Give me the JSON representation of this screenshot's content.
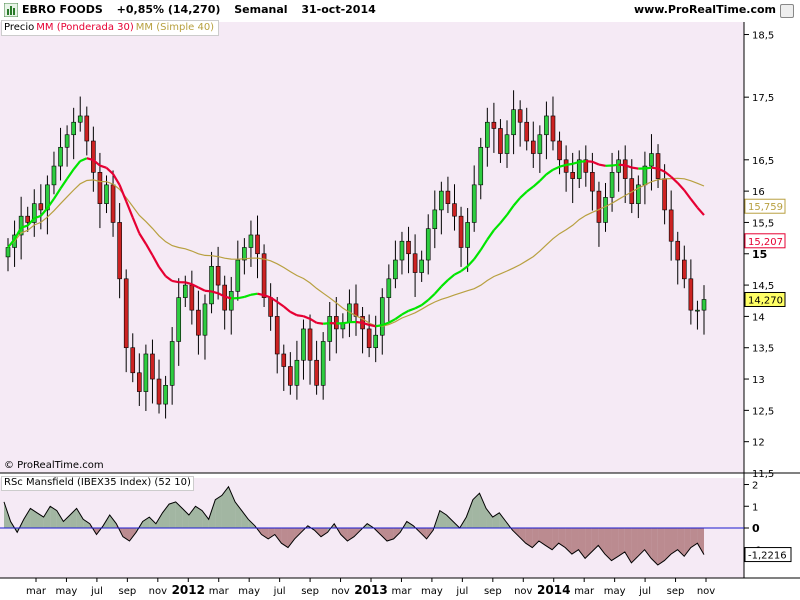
{
  "header": {
    "symbol": "EBRO FOODS",
    "change": "+0,85% (14,270)",
    "period": "Semanal",
    "date": "31-oct-2014",
    "site": "www.ProRealTime.com"
  },
  "legend": {
    "price": "Precio",
    "ma_weighted": "MM (Ponderada 30)",
    "ma_simple": "MM (Simple 40)"
  },
  "copyright": "© ProRealTime.com",
  "rsc_label": "RSc Mansfield (IBEX35 Index) (52 10)",
  "colors": {
    "background": "#f5eaf5",
    "ma_weighted": "#e60033",
    "ma_green": "#00e600",
    "ma_simple": "#b8a040",
    "rsc_pos": "#5c8a5c",
    "rsc_neg": "#8a3c3c"
  },
  "chart_data": [
    {
      "type": "candlestick",
      "name": "price",
      "yticks": [
        "18,5",
        "17,5",
        "16,5",
        "16",
        "15,5",
        "15",
        "14,5",
        "14",
        "13,5",
        "13",
        "12,5",
        "12",
        "11,5"
      ],
      "ylim": [
        11.5,
        18.7
      ],
      "xticks": [
        "mar",
        "may",
        "jul",
        "sep",
        "nov",
        "2012",
        "mar",
        "may",
        "jul",
        "sep",
        "nov",
        "2013",
        "mar",
        "may",
        "jul",
        "sep",
        "nov",
        "2014",
        "mar",
        "may",
        "jul",
        "sep",
        "nov"
      ],
      "markers": [
        {
          "label": "15,759",
          "value": 15.759,
          "color": "#b8a040"
        },
        {
          "label": "15,207",
          "value": 15.207,
          "color": "#e60033"
        },
        {
          "label": "14,270",
          "value": 14.27,
          "color": "#000000",
          "bg": "#ffff66"
        }
      ],
      "close": [
        15.1,
        15.3,
        15.6,
        15.5,
        15.8,
        15.7,
        16.1,
        16.4,
        16.7,
        16.9,
        17.1,
        17.2,
        16.8,
        16.3,
        15.8,
        16.1,
        15.5,
        14.6,
        13.5,
        13.1,
        12.8,
        13.4,
        13.0,
        12.6,
        12.9,
        13.6,
        14.3,
        14.5,
        14.1,
        13.7,
        14.2,
        14.8,
        14.5,
        14.1,
        14.4,
        14.9,
        15.1,
        15.3,
        15.0,
        14.3,
        14.0,
        13.4,
        13.2,
        12.9,
        13.3,
        13.8,
        13.3,
        12.9,
        13.6,
        14.0,
        13.8,
        13.9,
        14.2,
        14.0,
        13.8,
        13.5,
        13.7,
        14.3,
        14.6,
        14.9,
        15.2,
        15.0,
        14.7,
        14.9,
        15.4,
        15.7,
        16.0,
        15.8,
        15.6,
        15.1,
        15.5,
        16.1,
        16.7,
        17.1,
        17.0,
        16.6,
        16.9,
        17.3,
        17.1,
        16.8,
        16.6,
        16.9,
        17.2,
        16.8,
        16.5,
        16.3,
        16.2,
        16.5,
        16.3,
        16.0,
        15.5,
        15.9,
        16.3,
        16.5,
        16.2,
        15.8,
        16.1,
        16.4,
        16.6,
        16.2,
        15.7,
        15.2,
        14.9,
        14.6,
        14.1,
        14.1,
        14.27
      ],
      "series": [
        {
          "name": "MM (Ponderada 30)"
        },
        {
          "name": "MM (Simple 40)"
        }
      ]
    },
    {
      "type": "area",
      "name": "RSc Mansfield (IBEX35 Index) (52 10)",
      "yticks": [
        "2",
        "1",
        "0",
        "-1"
      ],
      "ylim": [
        -2.3,
        2.3
      ],
      "last_label": "-1,2216",
      "values": [
        1.2,
        0.3,
        -0.2,
        0.4,
        0.9,
        0.7,
        0.5,
        1.0,
        0.8,
        0.3,
        0.6,
        0.9,
        0.4,
        0.2,
        -0.3,
        0.1,
        0.6,
        0.2,
        -0.4,
        -0.6,
        -0.2,
        0.3,
        0.5,
        0.2,
        0.7,
        1.1,
        1.2,
        0.9,
        0.6,
        1.0,
        0.8,
        0.4,
        1.3,
        1.5,
        1.9,
        1.2,
        0.8,
        0.4,
        0.1,
        -0.3,
        -0.5,
        -0.3,
        -0.7,
        -0.9,
        -0.5,
        -0.2,
        0.1,
        -0.1,
        -0.4,
        -0.2,
        0.2,
        -0.3,
        -0.6,
        -0.4,
        -0.1,
        0.2,
        0.0,
        -0.3,
        -0.6,
        -0.5,
        -0.2,
        0.3,
        0.1,
        -0.2,
        -0.5,
        -0.1,
        0.8,
        0.6,
        0.3,
        0.0,
        0.5,
        1.3,
        1.6,
        0.9,
        0.5,
        0.7,
        0.3,
        -0.1,
        -0.4,
        -0.7,
        -0.9,
        -0.6,
        -0.8,
        -1.0,
        -0.7,
        -0.9,
        -1.2,
        -1.0,
        -1.4,
        -1.1,
        -0.8,
        -1.2,
        -1.5,
        -1.3,
        -1.1,
        -1.6,
        -1.3,
        -1.0,
        -1.4,
        -1.7,
        -1.5,
        -1.2,
        -1.0,
        -1.3,
        -0.9,
        -0.7,
        -1.2216
      ]
    }
  ]
}
